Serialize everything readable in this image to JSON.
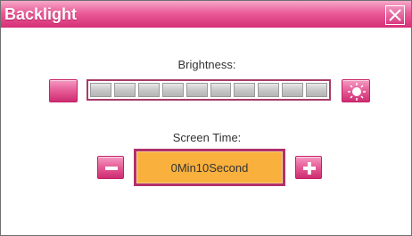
{
  "window": {
    "title": "Backlight"
  },
  "brightness": {
    "label": "Brightness:",
    "segments_total": 10,
    "level_filled": 0
  },
  "screen_time": {
    "label": "Screen Time:",
    "value": "0Min10Second"
  },
  "icons": {
    "close": "close-icon",
    "decrease_brightness": "moon-icon",
    "increase_brightness": "sun-icon",
    "decrease_time": "minus-icon",
    "increase_time": "plus-icon"
  },
  "colors": {
    "accent_pink": "#e55b96",
    "title_bar_pink": "#d62f77",
    "value_box_fill": "#f9b03d",
    "value_box_border": "#b2306c",
    "slider_border": "#a83b69",
    "segment_gray": "#c8c8c8"
  }
}
